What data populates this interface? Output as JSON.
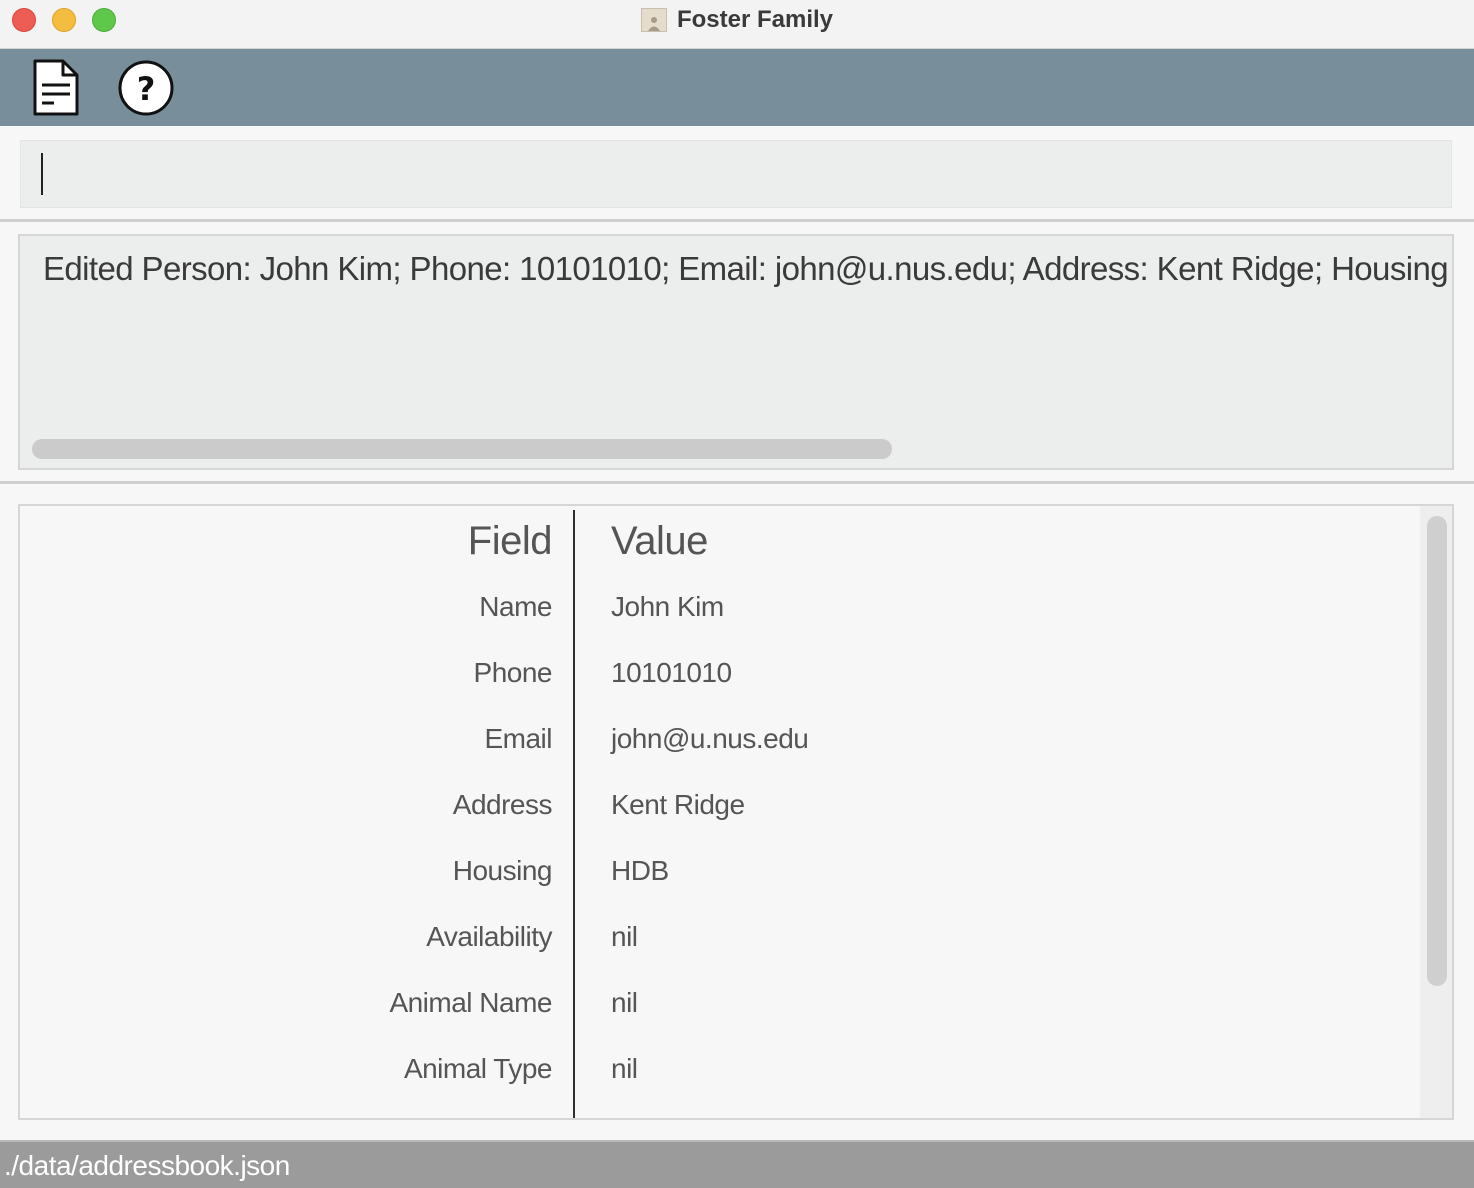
{
  "window": {
    "title": "Foster Family",
    "app_icon": "address-book-icon"
  },
  "toolbar": {
    "file_icon": "file-document-icon",
    "help_icon": "help-question-icon"
  },
  "command": {
    "value": ""
  },
  "result": {
    "text": "Edited Person: John Kim; Phone: 10101010; Email: john@u.nus.edu; Address: Kent Ridge; Housing"
  },
  "table": {
    "headers": {
      "field": "Field",
      "value": "Value"
    },
    "rows": [
      {
        "field": "Name",
        "value": "John Kim"
      },
      {
        "field": "Phone",
        "value": "10101010"
      },
      {
        "field": "Email",
        "value": "john@u.nus.edu"
      },
      {
        "field": "Address",
        "value": "Kent Ridge"
      },
      {
        "field": "Housing",
        "value": "HDB"
      },
      {
        "field": "Availability",
        "value": "nil"
      },
      {
        "field": "Animal Name",
        "value": "nil"
      },
      {
        "field": "Animal Type",
        "value": "nil"
      }
    ]
  },
  "status": {
    "path": "./data/addressbook.json"
  }
}
